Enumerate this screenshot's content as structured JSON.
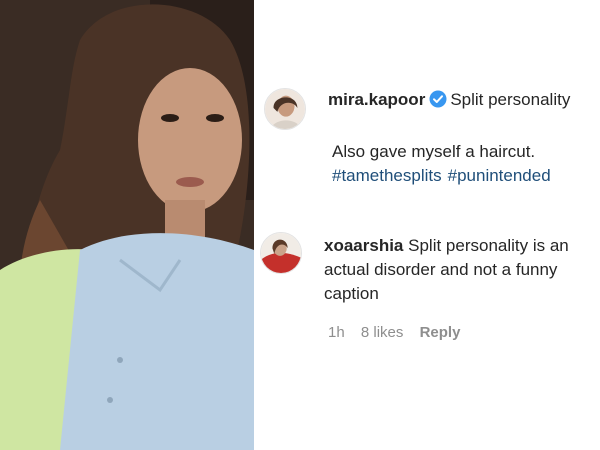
{
  "post": {
    "username": "mira.kapoor",
    "header_text": "Split personality",
    "caption_line1": "Also gave myself a haircut.",
    "hashtags": [
      "#tamethesplits",
      "#punintended"
    ]
  },
  "comment": {
    "username": "xoaarshia",
    "text": "Split personality is an actual disorder and not a funny caption",
    "time": "1h",
    "likes": "8 likes",
    "reply_label": "Reply"
  },
  "icons": {
    "verified": "verified-badge-icon"
  },
  "colors": {
    "verified": "#3897f0",
    "hashtag": "#1f4e79",
    "meta": "#8e8e8e"
  }
}
